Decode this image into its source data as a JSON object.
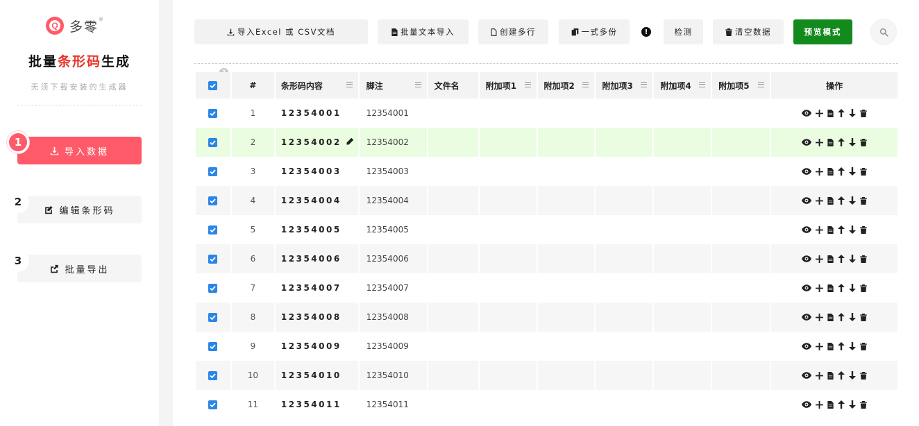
{
  "brand": {
    "logo_letter": "Q",
    "name": "多零",
    "reg": "®"
  },
  "app": {
    "title_pre": "批量",
    "title_hl": "条形码",
    "title_post": "生成",
    "subtitle": "无须下载安装的生成器"
  },
  "steps": [
    {
      "num": "1",
      "label": "导入数据",
      "icon": "download-icon",
      "active": true
    },
    {
      "num": "2",
      "label": "编辑条形码",
      "icon": "edit-icon",
      "active": false
    },
    {
      "num": "3",
      "label": "批量导出",
      "icon": "export-icon",
      "active": false
    }
  ],
  "toolbar": {
    "import_excel": "导入Excel 或 CSV文档",
    "batch_text": "批量文本导入",
    "create_rows": "创建多行",
    "copies": "一式多份",
    "alert": "!",
    "check": "检测",
    "clear": "清空数据",
    "preview": "预览模式"
  },
  "table": {
    "help": "?",
    "headers": {
      "num": "#",
      "code": "条形码内容",
      "note": "脚注",
      "file": "文件名",
      "x1": "附加项1",
      "x2": "附加项2",
      "x3": "附加项3",
      "x4": "附加项4",
      "x5": "附加项5",
      "ops": "操作"
    },
    "rows": [
      {
        "num": "1",
        "code": "12354001",
        "note": "12354001"
      },
      {
        "num": "2",
        "code": "12354002",
        "note": "12354002"
      },
      {
        "num": "3",
        "code": "12354003",
        "note": "12354003"
      },
      {
        "num": "4",
        "code": "12354004",
        "note": "12354004"
      },
      {
        "num": "5",
        "code": "12354005",
        "note": "12354005"
      },
      {
        "num": "6",
        "code": "12354006",
        "note": "12354006"
      },
      {
        "num": "7",
        "code": "12354007",
        "note": "12354007"
      },
      {
        "num": "8",
        "code": "12354008",
        "note": "12354008"
      },
      {
        "num": "9",
        "code": "12354009",
        "note": "12354009"
      },
      {
        "num": "10",
        "code": "12354010",
        "note": "12354010"
      },
      {
        "num": "11",
        "code": "12354011",
        "note": "12354011"
      }
    ],
    "selected_row": 2
  },
  "colors": {
    "accent": "#ff5a6a",
    "primary_green": "#128a1c",
    "checkbox_blue": "#2a86e6",
    "selected_row": "#eafde0",
    "title_highlight": "#e8342c"
  }
}
